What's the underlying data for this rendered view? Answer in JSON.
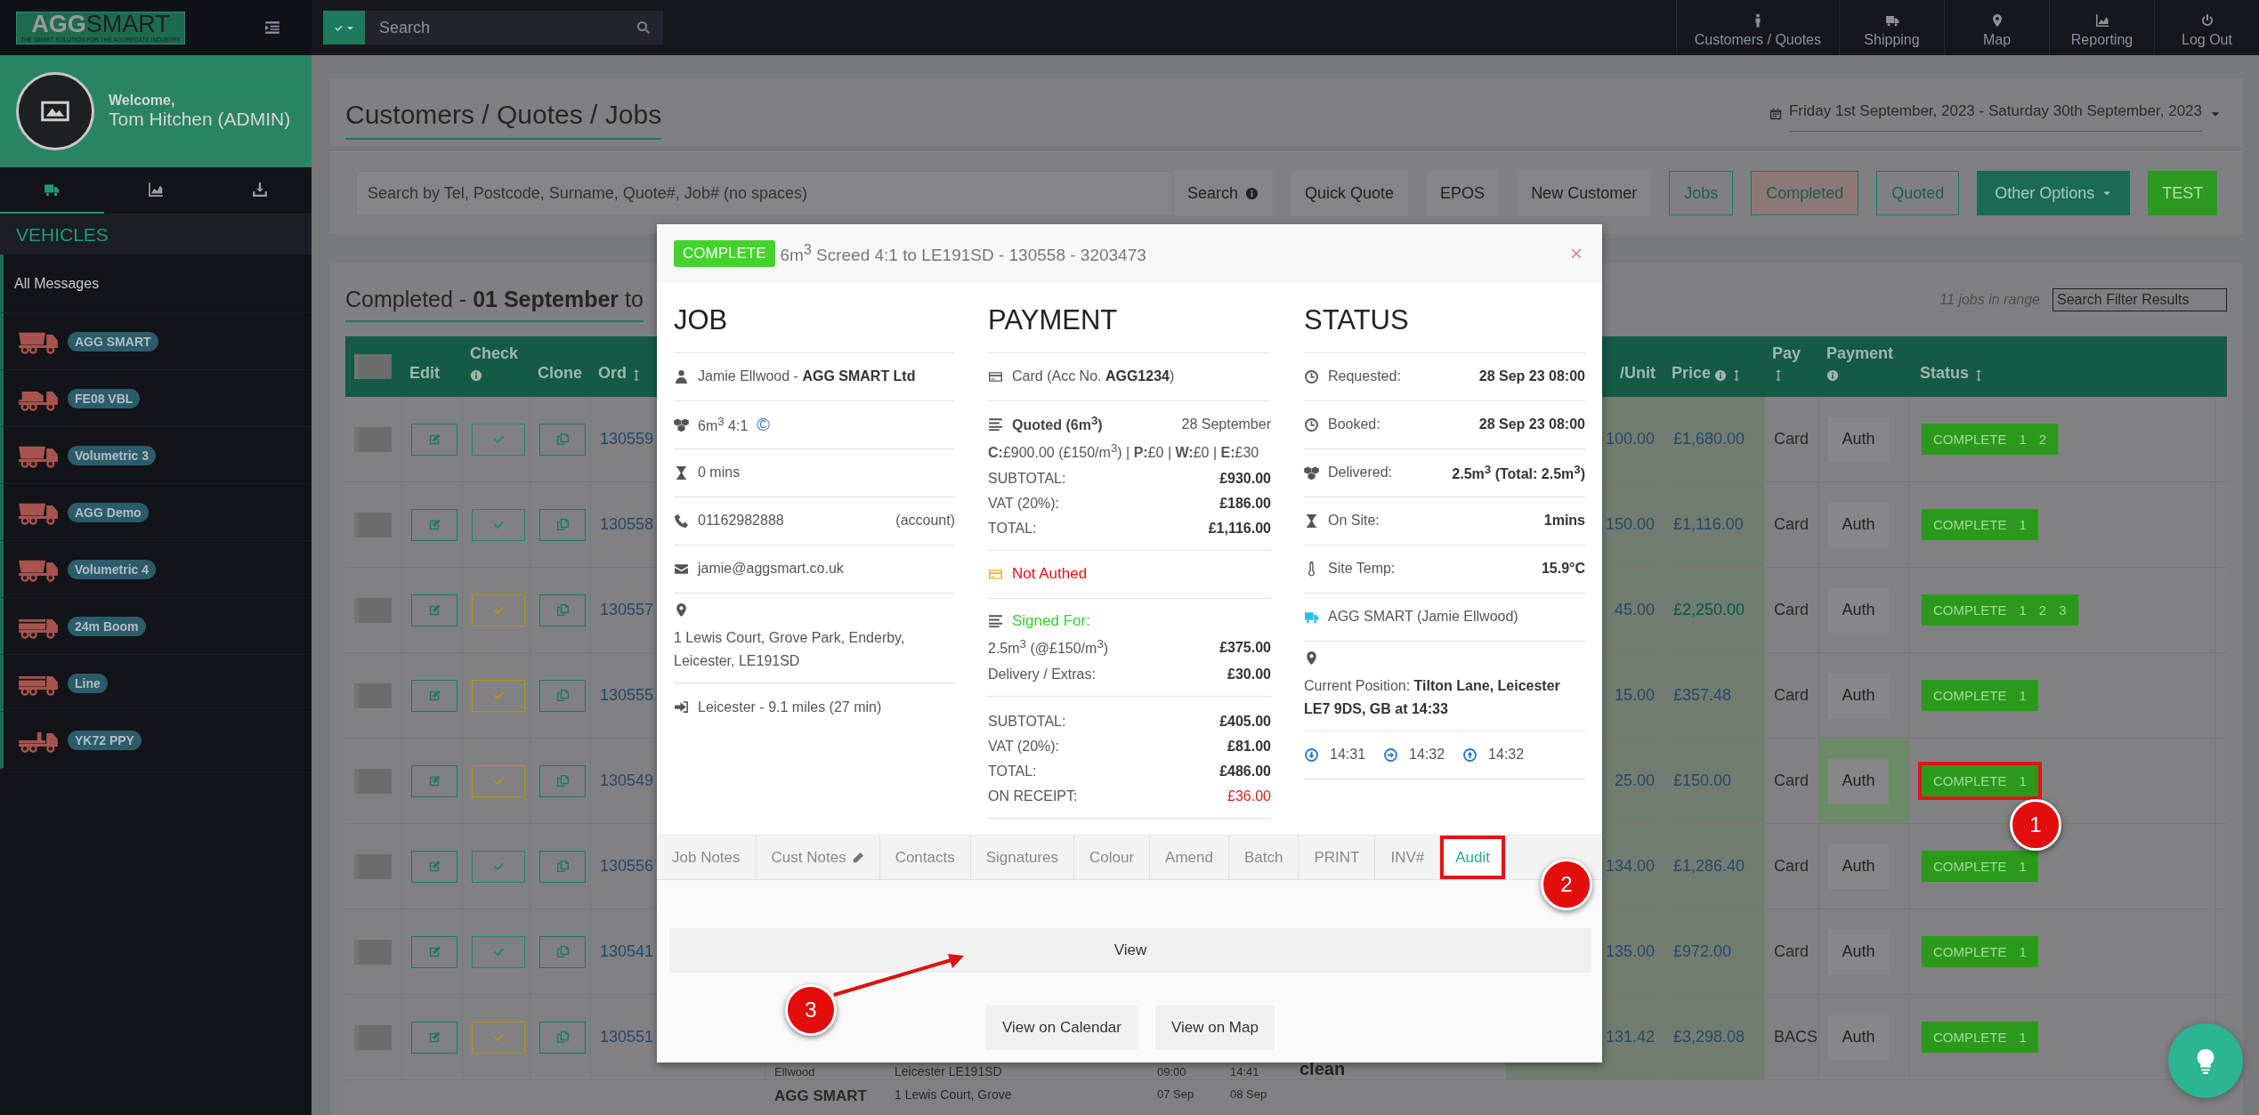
{
  "topbar": {
    "logo": {
      "wordmark_bold": "AGG",
      "wordmark_light": "SMART",
      "tagline": "THE SMART SOLUTION FOR THE AGGREGATE INDUSTRY"
    },
    "search": {
      "placeholder": "Search"
    },
    "nav": [
      {
        "kind": "person",
        "label": "Customers / Quotes"
      },
      {
        "kind": "truck",
        "label": "Shipping"
      },
      {
        "kind": "pin",
        "label": "Map"
      },
      {
        "kind": "chart",
        "label": "Reporting"
      },
      {
        "kind": "power",
        "label": "Log Out"
      }
    ]
  },
  "sidebar": {
    "welcome": "Welcome,",
    "user": "Tom Hitchen (ADMIN)",
    "tabs": [
      {
        "kind": "truck",
        "selected": true
      },
      {
        "kind": "chart",
        "selected": false
      },
      {
        "kind": "download",
        "selected": false
      }
    ],
    "section": "VEHICLES",
    "all_messages": "All Messages",
    "vehicles": [
      {
        "kind": "tipper",
        "label": "AGG SMART"
      },
      {
        "kind": "mixer",
        "label": "FE08 VBL"
      },
      {
        "kind": "tipper",
        "label": "Volumetric 3"
      },
      {
        "kind": "tipper",
        "label": "AGG Demo"
      },
      {
        "kind": "tipper",
        "label": "Volumetric 4"
      },
      {
        "kind": "boom",
        "label": "24m Boom"
      },
      {
        "kind": "boom",
        "label": "Line"
      },
      {
        "kind": "flatbed",
        "label": "YK72 PPY"
      }
    ]
  },
  "page": {
    "title": "Customers / Quotes / Jobs",
    "date_range": "Friday 1st September, 2023 - Saturday 30th September, 2023",
    "search": {
      "placeholder": "Search by Tel, Postcode, Surname, Quote#, Job# (no spaces)"
    },
    "buttons": [
      {
        "label": "Search",
        "kind": "info"
      },
      {
        "label": "Quick Quote",
        "kind": "plain"
      },
      {
        "label": "EPOS",
        "kind": "plain"
      },
      {
        "label": "New Customer",
        "kind": "plain"
      },
      {
        "label": "Jobs",
        "kind": "outline"
      },
      {
        "label": "Completed",
        "kind": "outline-active"
      },
      {
        "label": "Quoted",
        "kind": "outline"
      },
      {
        "label": "Other Options",
        "kind": "dropdown"
      },
      {
        "label": "TEST",
        "kind": "test"
      }
    ]
  },
  "jobs": {
    "heading": "Completed - **01 September** to",
    "count": "11 jobs in range",
    "filter": {
      "placeholder": "Search Filter Results"
    },
    "select_all": {
      "checked": false
    },
    "columns": [
      {
        "label": "Edit",
        "info": false,
        "sort": false
      },
      {
        "label": "Check",
        "info": true,
        "sort": false
      },
      {
        "label": "Clone",
        "info": false,
        "sort": false
      },
      {
        "label": "Ord",
        "info": false,
        "sort": true
      },
      {
        "label": "/Unit",
        "info": false,
        "sort": false
      },
      {
        "label": "Price",
        "info": true,
        "sort": true
      },
      {
        "label": "Pay",
        "info": false,
        "sort": true
      },
      {
        "label": "Payment",
        "info": true,
        "sort": false
      },
      {
        "label": "Status",
        "info": false,
        "sort": true
      }
    ],
    "rows": [
      {
        "checked": false,
        "order": "130559",
        "check": {
          "color": "#1d8a6a"
        },
        "unit": "100.00",
        "price": "£1,680.00",
        "price_flagged": false,
        "pay": "Card",
        "payment": "Auth",
        "payment_done": false,
        "status": "COMPLETE",
        "steps": [
          "1",
          "2"
        ],
        "marked": false
      },
      {
        "checked": false,
        "order": "130558",
        "check": {
          "color": "#1d8a6a"
        },
        "unit": "150.00",
        "price": "£1,116.00",
        "price_flagged": false,
        "pay": "Card",
        "payment": "Auth",
        "payment_done": false,
        "status": "COMPLETE",
        "steps": [
          "1"
        ],
        "marked": false
      },
      {
        "checked": false,
        "order": "130557",
        "check": {
          "color": "#b8901c"
        },
        "unit": "45.00",
        "price": "£2,250.00",
        "price_flagged": true,
        "pay": "Card",
        "payment": "Auth",
        "payment_done": false,
        "status": "COMPLETE",
        "steps": [
          "1",
          "2",
          "3"
        ],
        "marked": false
      },
      {
        "checked": false,
        "order": "130555",
        "check": {
          "color": "#b8901c"
        },
        "unit": "15.00",
        "price": "£357.48",
        "price_flagged": false,
        "pay": "Card",
        "payment": "Auth",
        "payment_done": false,
        "status": "COMPLETE",
        "steps": [
          "1"
        ],
        "marked": false
      },
      {
        "checked": false,
        "order": "130549",
        "check": {
          "color": "#b8901c"
        },
        "unit": "25.00",
        "price": "£150.00",
        "price_flagged": false,
        "pay": "Card",
        "payment": "Auth",
        "payment_done": true,
        "status": "COMPLETE",
        "steps": [
          "1"
        ],
        "marked": true
      },
      {
        "checked": false,
        "order": "130556",
        "check": {
          "color": "#1d8a6a"
        },
        "unit": "134.00",
        "price": "£1,286.40",
        "price_flagged": false,
        "pay": "Card",
        "payment": "Auth",
        "payment_done": false,
        "status": "COMPLETE",
        "steps": [
          "1"
        ],
        "marked": false
      },
      {
        "checked": false,
        "order": "130541",
        "check": {
          "color": "#1d8a6a"
        },
        "unit": "135.00",
        "price": "£972.00",
        "price_flagged": false,
        "pay": "Card",
        "payment": "Auth",
        "payment_done": false,
        "status": "COMPLETE",
        "steps": [
          "1"
        ],
        "marked": false
      },
      {
        "checked": false,
        "order": "130551",
        "check": {
          "color": "#b8901c"
        },
        "customer": "Ellwood",
        "address": "Leicester LE191SD",
        "time_1": "09:00",
        "time_2": "14:41",
        "note": "clean",
        "unit": "131.42",
        "price": "£3,298.08",
        "price_flagged": false,
        "pay": "BACS",
        "payment": "Auth",
        "payment_done": false,
        "status": "COMPLETE",
        "steps": [
          "1"
        ],
        "marked": false
      },
      {
        "customer": "AGG SMART",
        "address": "1 Lewis Court, Grove",
        "time_1": "07 Sep",
        "time_2": "08 Sep"
      }
    ]
  },
  "modal": {
    "badge": "COMPLETE",
    "title": "6m$^{3}$ Screed 4:1 to LE191SD - 130558 - 3203473",
    "close": "×",
    "job": {
      "heading": "JOB",
      "rows": [
        {
          "kind": "user",
          "text": "Jamie Ellwood - **AGG SMART Ltd**"
        },
        {
          "kind": "cubes",
          "text": "6m$^{3}$ 4:1",
          "symbol": "©"
        },
        {
          "kind": "hourglass",
          "text": "0 mins"
        },
        {
          "kind": "phone",
          "text": "01162982888",
          "aside": "(account)"
        },
        {
          "kind": "envelope",
          "text": "jamie@aggsmart.co.uk"
        },
        {
          "kind": "pin",
          "text": "1 Lewis Court, Grove Park, Enderby, Leicester, LE191SD"
        },
        {
          "kind": "signout",
          "text": "Leicester - 9.1 miles (27 min)"
        }
      ]
    },
    "payment": {
      "heading": "PAYMENT",
      "card": "Card (Acc No. **AGG1234**)",
      "quote": {
        "title": "Quoted (6m$^{3}$)",
        "date": "28 September",
        "breakdown": "**C:**£900.00 (£150/m$^{3}$) | **P:**£0 | **W:**£0 | **E:**£30",
        "lines": [
          {
            "label": "SUBTOTAL:",
            "value": "£930.00"
          },
          {
            "label": "VAT (20%):",
            "value": "£186.00"
          },
          {
            "label": "TOTAL:",
            "value": "£1,116.00"
          }
        ]
      },
      "auth": "Not Authed",
      "signed": {
        "title": "Signed For:",
        "lines": [
          {
            "label": "2.5m$^{3}$ (@£150/m$^{3}$)",
            "value": "£375.00"
          },
          {
            "label": "Delivery / Extras:",
            "value": "£30.00"
          }
        ]
      },
      "totals": [
        {
          "label": "SUBTOTAL:",
          "value": "£405.00",
          "alert": false
        },
        {
          "label": "VAT (20%):",
          "value": "£81.00",
          "alert": false
        },
        {
          "label": "TOTAL:",
          "value": "£486.00",
          "alert": false
        },
        {
          "label": "ON RECEIPT:",
          "value": "£36.00",
          "alert": true
        }
      ]
    },
    "status": {
      "heading": "STATUS",
      "rows": [
        {
          "kind": "clock",
          "label": "Requested:",
          "value": "28 Sep 23 08:00"
        },
        {
          "kind": "clock",
          "label": "Booked:",
          "value": "28 Sep 23 08:00"
        },
        {
          "kind": "cubes",
          "label": "Delivered:",
          "value": "2.5m$^{3}$ (Total: 2.5m$^{3}$)"
        },
        {
          "kind": "hourglass",
          "label": "On Site:",
          "value": "1mins"
        },
        {
          "kind": "thermometer",
          "label": "Site Temp:",
          "value": "15.9°C"
        },
        {
          "kind": "truck",
          "label": "AGG SMART (Jamie Ellwood)"
        },
        {
          "kind": "pin",
          "label": "Current Position: **Tilton Lane, Leicester LE7 9DS, GB at 14:33**"
        }
      ],
      "times": [
        {
          "kind": "down",
          "time": "14:31"
        },
        {
          "kind": "right",
          "time": "14:32"
        },
        {
          "kind": "up",
          "time": "14:32"
        }
      ]
    },
    "tabs": [
      {
        "label": "Job Notes",
        "pencil": false,
        "selected": false,
        "marked": false
      },
      {
        "label": "Cust Notes",
        "pencil": true,
        "selected": false,
        "marked": false
      },
      {
        "label": "Contacts",
        "pencil": false,
        "selected": false,
        "marked": false
      },
      {
        "label": "Signatures",
        "pencil": false,
        "selected": false,
        "marked": false
      },
      {
        "label": "Colour",
        "pencil": false,
        "selected": false,
        "marked": false
      },
      {
        "label": "Amend",
        "pencil": false,
        "selected": false,
        "marked": false
      },
      {
        "label": "Batch",
        "pencil": false,
        "selected": false,
        "marked": false
      },
      {
        "label": "PRINT",
        "pencil": false,
        "selected": false,
        "marked": false
      },
      {
        "label": "INV#",
        "pencil": false,
        "selected": false,
        "marked": false
      },
      {
        "label": "Audit",
        "pencil": false,
        "selected": true,
        "marked": true
      }
    ],
    "view": "View",
    "actions": [
      "View on Calendar",
      "View on Map"
    ]
  },
  "annotations": [
    {
      "label": "1"
    },
    {
      "label": "2"
    },
    {
      "label": "3"
    }
  ]
}
